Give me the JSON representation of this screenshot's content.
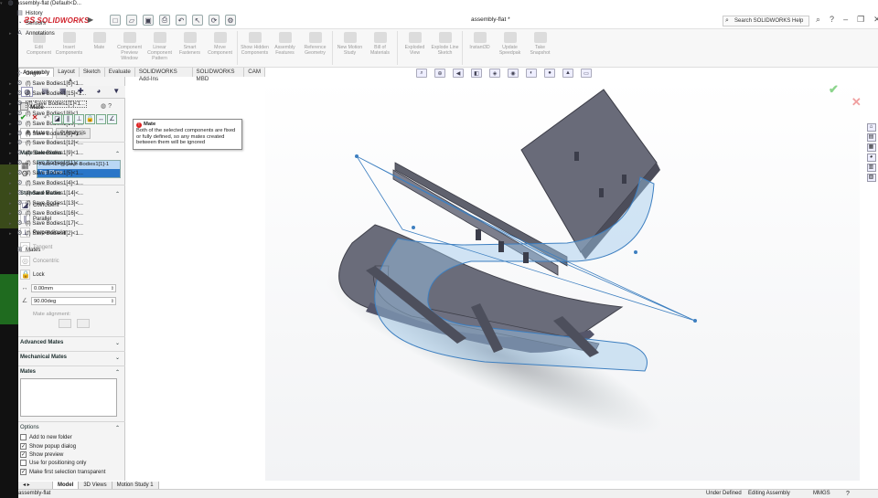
{
  "app": {
    "logo": "SOLIDWORKS",
    "doc_title": "assembly-flat *",
    "search_placeholder": "Search SOLIDWORKS Help"
  },
  "ribbon": [
    {
      "label": "Edit Component"
    },
    {
      "label": "Insert Components"
    },
    {
      "label": "Mate"
    },
    {
      "label": "Component Preview Window"
    },
    {
      "label": "Linear Component Pattern"
    },
    {
      "label": "Smart Fasteners"
    },
    {
      "label": "Move Component"
    },
    {
      "label": "Show Hidden Components"
    },
    {
      "label": "Assembly Features"
    },
    {
      "label": "Reference Geometry"
    },
    {
      "label": "New Motion Study"
    },
    {
      "label": "Bill of Materials"
    },
    {
      "label": "Exploded View"
    },
    {
      "label": "Explode Line Sketch"
    },
    {
      "label": "Instant3D"
    },
    {
      "label": "Update Speedpak"
    },
    {
      "label": "Take Snapshot"
    }
  ],
  "tabs": [
    "Assembly",
    "Layout",
    "Sketch",
    "Evaluate",
    "SOLIDWORKS Add-Ins",
    "SOLIDWORKS MBD",
    "CAM"
  ],
  "panel": {
    "title": "Mate",
    "subtabs": [
      "Mates",
      "Analysis"
    ],
    "mate_selections_header": "Mate Selections",
    "selections": [
      "Face<1>@Save Bodies1[1]-1",
      "Top Plane"
    ],
    "standard_mates_header": "Standard Mates",
    "standard_mates": [
      "Coincident",
      "Parallel",
      "Perpendicular",
      "Tangent",
      "Concentric",
      "Lock"
    ],
    "distance": "0.00mm",
    "angle": "90.00deg",
    "mate_alignment": "Mate alignment:",
    "advanced_header": "Advanced Mates",
    "mechanical_header": "Mechanical Mates",
    "mates_header": "Mates",
    "options_header": "Options",
    "options": [
      {
        "label": "Add to new folder",
        "checked": false
      },
      {
        "label": "Show popup dialog",
        "checked": true
      },
      {
        "label": "Show preview",
        "checked": true
      },
      {
        "label": "Use for positioning only",
        "checked": false
      },
      {
        "label": "Make first selection transparent",
        "checked": true
      }
    ]
  },
  "tooltip": {
    "title": "Mate",
    "body": "Both of the selected components are fixed or fully defined, so any mates created between them will be ignored"
  },
  "tree": {
    "root": "assembly-flat  (Default<D...",
    "items": [
      "History",
      "Sensors",
      "Annotations",
      "Origin"
    ],
    "bodies": [
      "(f) Save Bodies1[6]<1...",
      "(f) Save Bodies1[15]<1...",
      "(f) Save Bodies1[1]<1...",
      "(f) Save Bodies1[8]<1...",
      "(f) Save Bodies1[10]<...",
      "(f) Save Bodies1[3]<1...",
      "(f) Save Bodies1[12]<...",
      "(f) Save Bodies1[9]<1...",
      "(f) Save Bodies1[11]<...",
      "(f) Save Bodies1[5]<1...",
      "(f) Save Bodies1[4]<1...",
      "(f) Save Bodies1[14]<...",
      "(f) Save Bodies1[13]<...",
      "(f) Save Bodies1[16]<...",
      "(f) Save Bodies1[17]<...",
      "(f) Save Bodies1[2]<1..."
    ],
    "mates": "Mates"
  },
  "bottom_tabs": [
    "Model",
    "3D Views",
    "Motion Study 1"
  ],
  "status": {
    "file": "assembly-flat",
    "state": "Under Defined",
    "mode": "Editing Assembly",
    "units": "MMGS"
  }
}
